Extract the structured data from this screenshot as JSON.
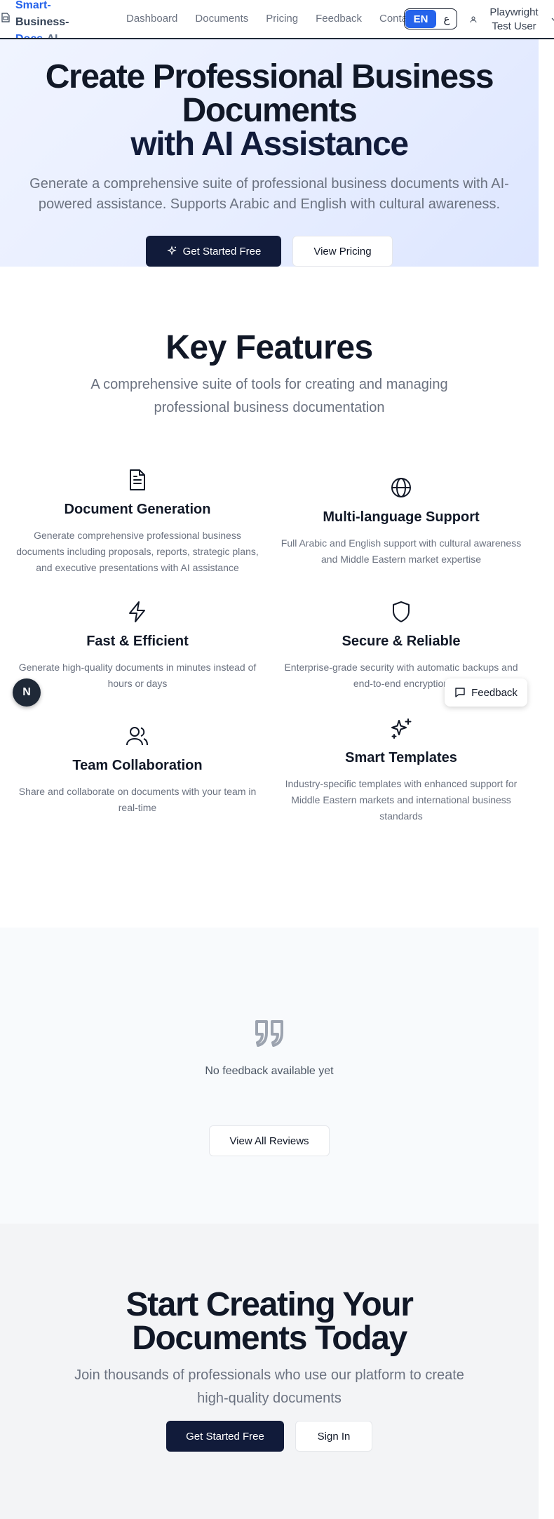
{
  "header": {
    "logo": {
      "part1": "Smart-",
      "part2": "Business-",
      "part3": "Docs",
      "part4": "-AI"
    },
    "nav": [
      "Dashboard",
      "Documents",
      "Pricing",
      "Feedback",
      "Contact"
    ],
    "lang": {
      "en": "EN",
      "ar": "ع"
    },
    "user_name": "Playwright Test User"
  },
  "hero": {
    "title_line1": "Create Professional Business Documents",
    "title_line2": "with AI Assistance",
    "subtitle": "Generate a comprehensive suite of professional business documents with AI-powered assistance. Supports Arabic and English with cultural awareness.",
    "primary_button": "Get Started Free",
    "secondary_button": "View Pricing"
  },
  "features": {
    "title": "Key Features",
    "subtitle": "A comprehensive suite of tools for creating and managing professional business documentation",
    "items": [
      {
        "icon": "file-text-icon",
        "name": "Document Generation",
        "desc": "Generate comprehensive professional business documents including proposals, reports, strategic plans, and executive presentations with AI assistance"
      },
      {
        "icon": "globe-icon",
        "name": "Multi-language Support",
        "desc": "Full Arabic and English support with cultural awareness and Middle Eastern market expertise"
      },
      {
        "icon": "zap-icon",
        "name": "Fast & Efficient",
        "desc": "Generate high-quality documents in minutes instead of hours or days"
      },
      {
        "icon": "shield-icon",
        "name": "Secure & Reliable",
        "desc": "Enterprise-grade security with automatic backups and end-to-end encryption"
      },
      {
        "icon": "users-icon",
        "name": "Team Collaboration",
        "desc": "Share and collaborate on documents with your team in real-time"
      },
      {
        "icon": "sparkles-icon",
        "name": "Smart Templates",
        "desc": "Industry-specific templates with enhanced support for Middle Eastern markets and international business standards"
      }
    ]
  },
  "floating": {
    "next_badge": "N",
    "feedback_label": "Feedback"
  },
  "reviews": {
    "empty_text": "No feedback available yet",
    "view_all": "View All Reviews"
  },
  "cta": {
    "title": "Start Creating Your Documents Today",
    "subtitle": "Join thousands of professionals who use our platform to create high-quality documents",
    "primary_button": "Get Started Free",
    "secondary_button": "Sign In"
  }
}
